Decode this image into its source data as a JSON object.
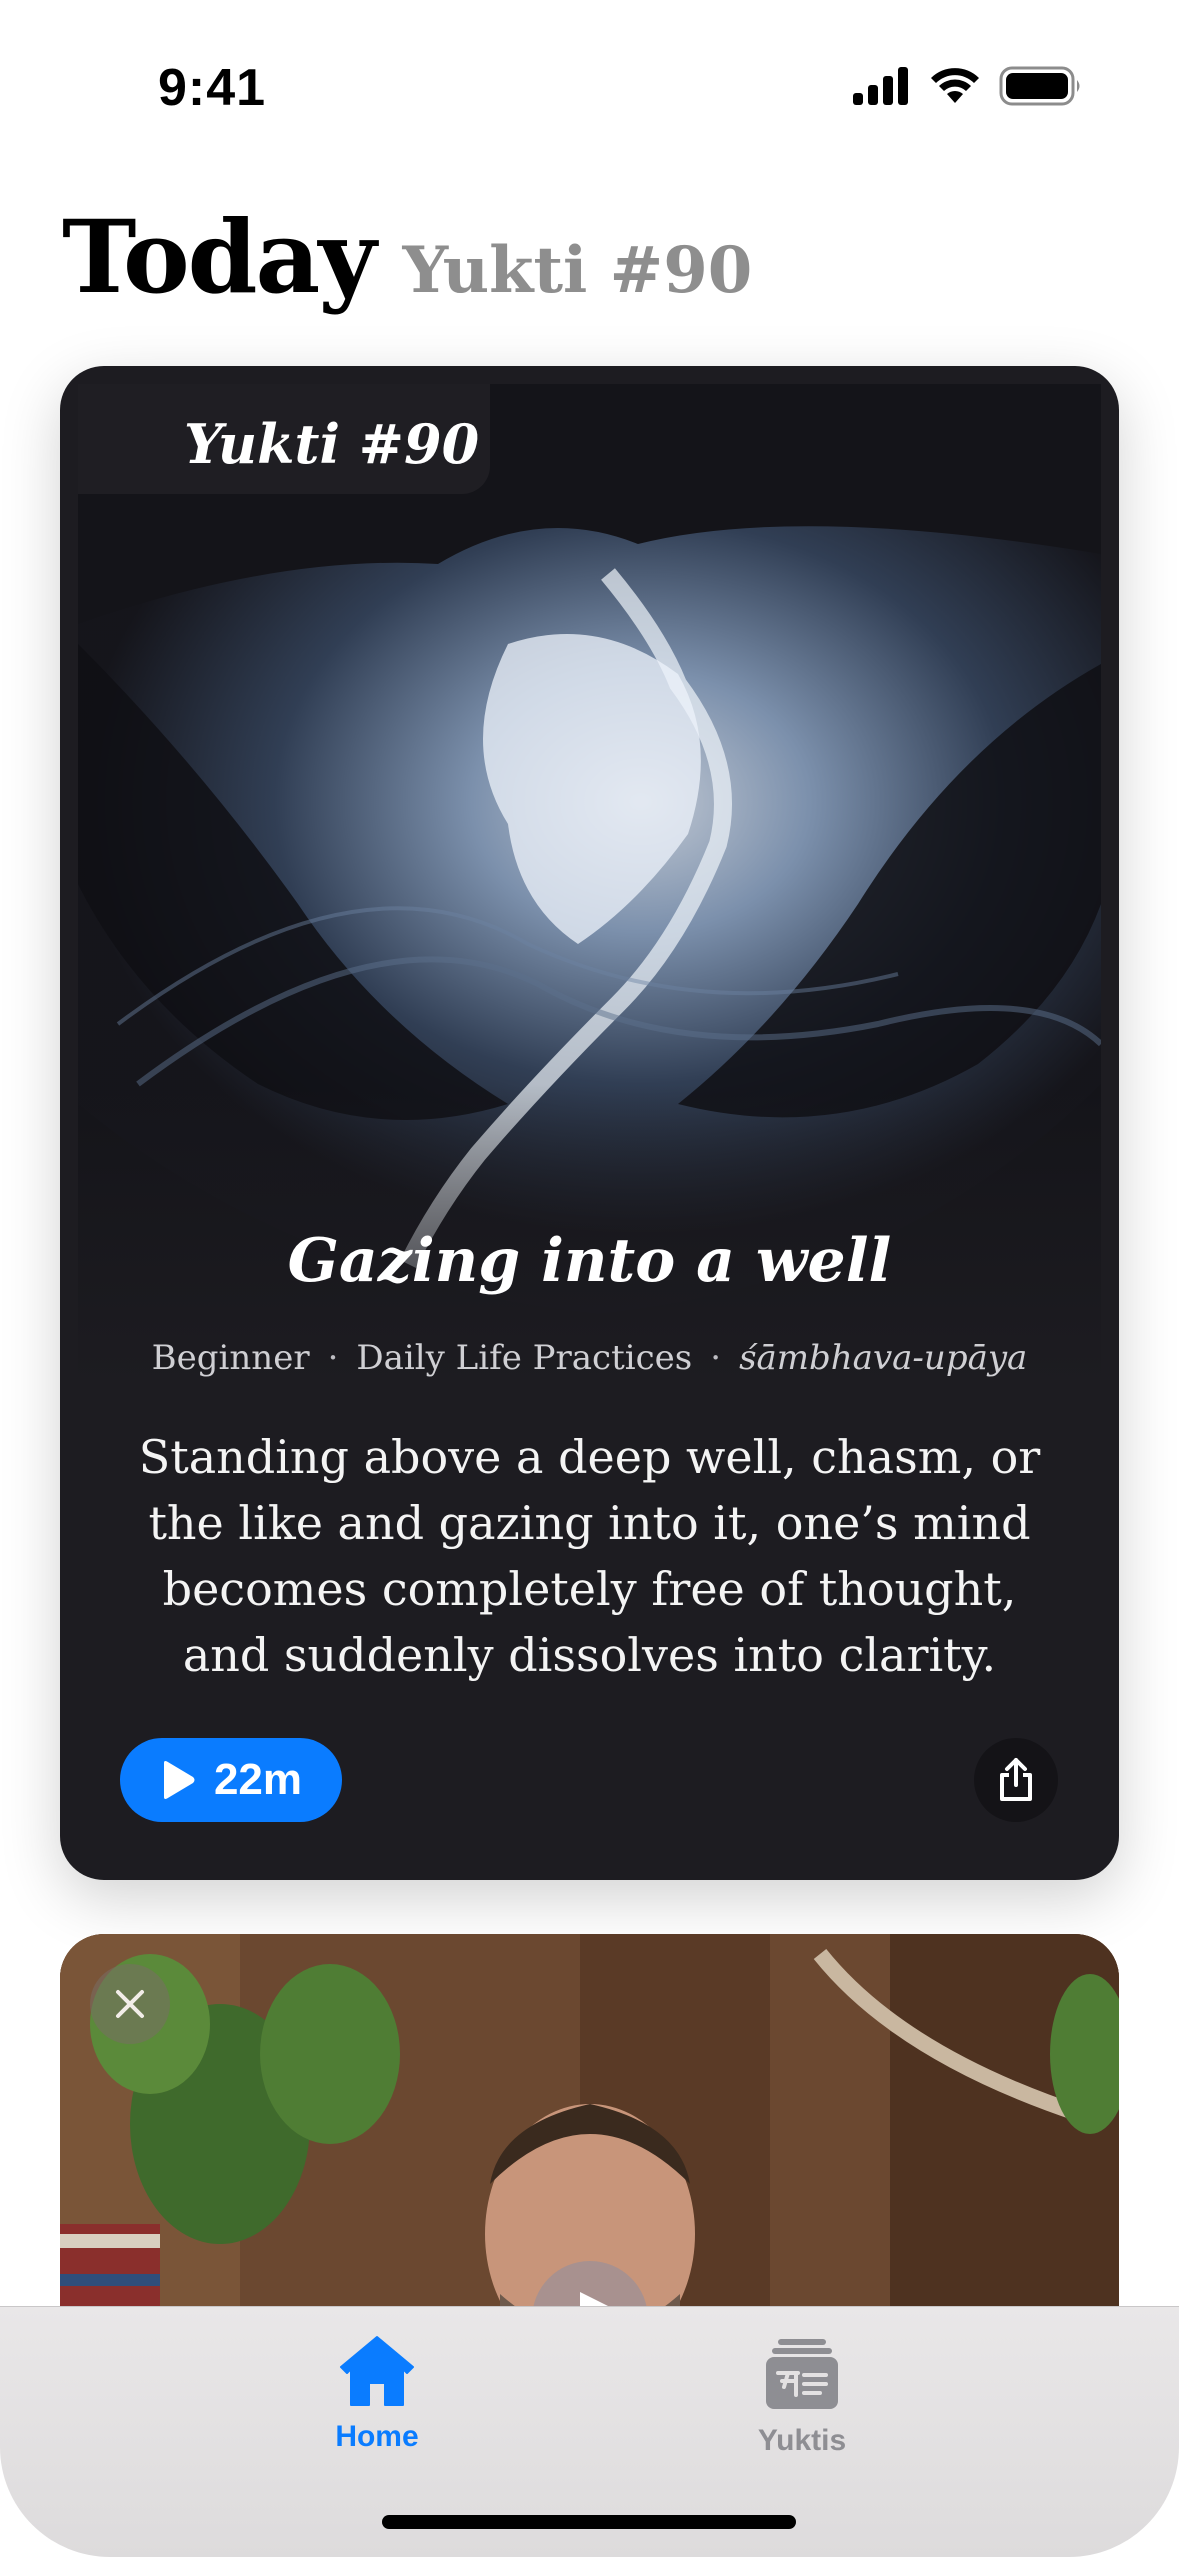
{
  "status_bar": {
    "time": "9:41",
    "icons": [
      "cellular-signal-icon",
      "wifi-icon",
      "battery-icon"
    ]
  },
  "header": {
    "title": "Today",
    "subtitle": "Yukti #90"
  },
  "featured_card": {
    "badge": "Yukti #90",
    "title": "Gazing into a well",
    "meta": {
      "level": "Beginner",
      "category": "Daily Life Practices",
      "upaya": "śāmbhava-upāya"
    },
    "description": "Standing above a deep well, chasm, or the like and gazing into it, one’s mind becomes completely free of thought, and suddenly dissolves into clarity.",
    "duration": "22m",
    "icons": {
      "play": "play-icon",
      "share": "share-icon"
    }
  },
  "video_card": {
    "close_icon": "close-icon",
    "play_icon": "play-icon"
  },
  "tab_bar": {
    "tabs": [
      {
        "label": "Home",
        "icon": "home-icon",
        "active": true
      },
      {
        "label": "Yuktis",
        "icon": "book-stack-icon",
        "active": false
      }
    ]
  },
  "colors": {
    "accent": "#0a7cff",
    "card_bg": "#1d1c21",
    "inactive_tab": "#8e8e93"
  }
}
